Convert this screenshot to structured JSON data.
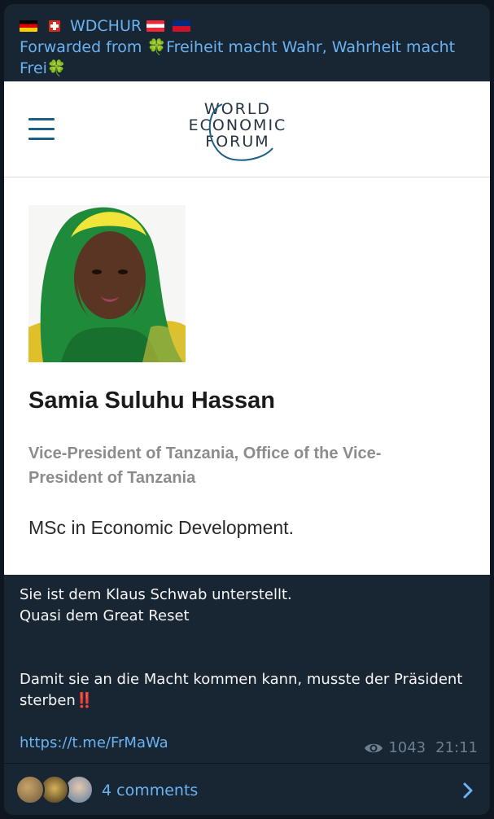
{
  "post": {
    "channel_name": "WDCHUR",
    "forwarded_prefix": "Forwarded from ",
    "forwarded_source": "Freiheit macht Wahr, Wahrheit macht Frei",
    "clover_emoji": "🍀"
  },
  "screenshot": {
    "logo_lines": [
      "WORLD",
      "ECONOMIC",
      "FORUM"
    ],
    "person_name": "Samia Suluhu Hassan",
    "person_role": "Vice-President of Tanzania, Office of the Vice-President of Tanzania",
    "person_degree": "MSc in Economic Development.",
    "colors": {
      "logo_arc": "#1c5e86",
      "hamburger": "#1c5e86"
    }
  },
  "message": {
    "line1": "Sie ist dem Klaus Schwab unterstellt.",
    "line2": "Quasi dem Great Reset",
    "line3": "Damit sie an die Macht kommen kann, musste der Präsident sterben",
    "exclamation_emoji": "‼️",
    "link": "https://t.me/FrMaWa"
  },
  "meta": {
    "views": "1043",
    "time": "21:11"
  },
  "comments": {
    "label": "4 comments"
  },
  "icons": [
    "menu-icon",
    "eye-icon",
    "chevron-right-icon",
    "flag-germany-icon",
    "flag-switzerland-icon",
    "flag-austria-icon",
    "flag-liechtenstein-icon",
    "clover-icon"
  ],
  "theme": {
    "link_color": "#6ab3f3",
    "bubble_bg": "#182533",
    "page_bg": "#0e1621"
  }
}
